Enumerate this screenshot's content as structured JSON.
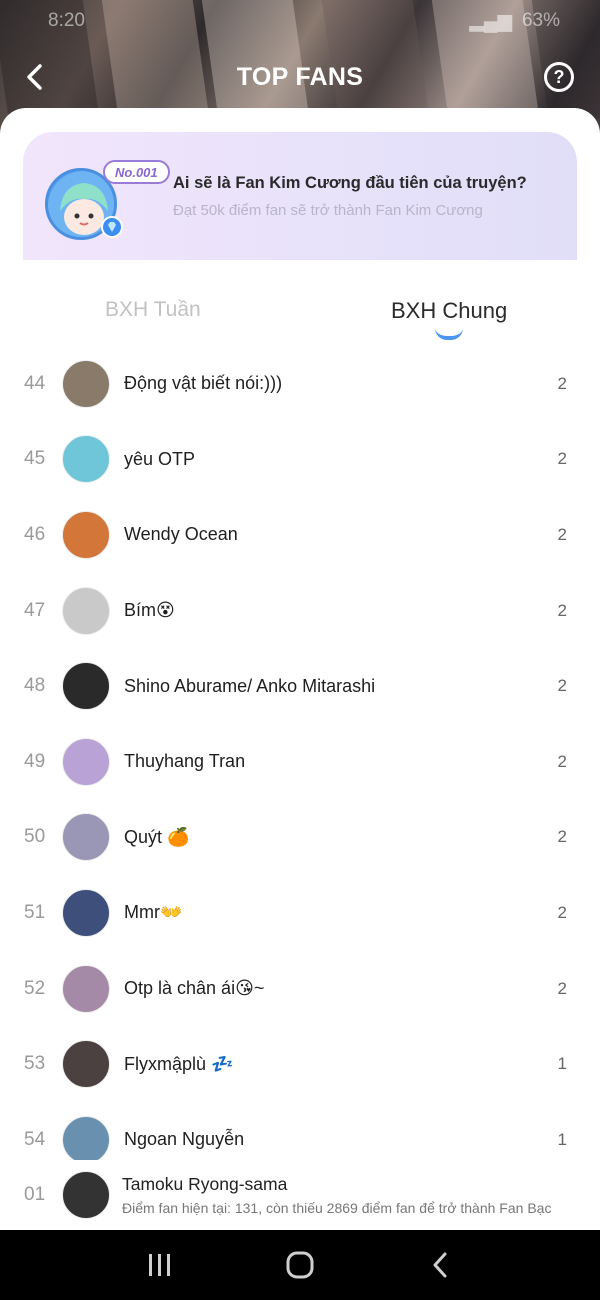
{
  "status_bar": {
    "time": "8:20",
    "battery": "63%"
  },
  "header": {
    "title": "TOP FANS"
  },
  "banner": {
    "badge": "No.001",
    "title": "Ai sẽ là Fan Kim Cương đầu tiên của truyện?",
    "subtitle": "Đạt 50k điểm fan sẽ trở thành Fan Kim Cương"
  },
  "tabs": [
    {
      "label": "BXH Tuần",
      "active": false
    },
    {
      "label": "BXH Chung",
      "active": true
    }
  ],
  "fans": [
    {
      "rank": "44",
      "name": "Động vật biết nói:)))",
      "score": "2",
      "avatar_color": "#8a7a6a"
    },
    {
      "rank": "45",
      "name": "yêu OTP",
      "score": "2",
      "avatar_color": "#6fc6d8"
    },
    {
      "rank": "46",
      "name": "Wendy Ocean",
      "score": "2",
      "avatar_color": "#d2763a"
    },
    {
      "rank": "47",
      "name": "Bím😵",
      "score": "2",
      "avatar_color": "#c9c9c9"
    },
    {
      "rank": "48",
      "name": "Shino Aburame/ Anko Mitarashi",
      "score": "2",
      "avatar_color": "#2a2a2a"
    },
    {
      "rank": "49",
      "name": "Thuyhang Tran",
      "score": "2",
      "avatar_color": "#b9a2d6"
    },
    {
      "rank": "50",
      "name": "Quýt 🍊",
      "score": "2",
      "avatar_color": "#9a96b5"
    },
    {
      "rank": "51",
      "name": "Mmr👐",
      "score": "2",
      "avatar_color": "#3d4f7a"
    },
    {
      "rank": "52",
      "name": "Otp là chân ái😘~",
      "score": "2",
      "avatar_color": "#a58aa8"
    },
    {
      "rank": "53",
      "name": "Flyxmậplù 💤",
      "score": "1",
      "avatar_color": "#4b4141"
    },
    {
      "rank": "54",
      "name": "Ngoan Nguyễn",
      "score": "1",
      "avatar_color": "#6a90b0"
    }
  ],
  "me": {
    "rank": "01",
    "name": "Tamoku Ryong-sama",
    "desc": "Điểm fan hiện tại: 131, còn thiếu 2869 điểm fan để trở thành Fan Bạc",
    "avatar_color": "#333333"
  },
  "colors": {
    "accent": "#4a96f0",
    "badge": "#8a67cf"
  },
  "icons": [
    "back-arrow-icon",
    "help-icon",
    "diamond-icon",
    "recents-icon",
    "home-icon",
    "back-nav-icon"
  ]
}
